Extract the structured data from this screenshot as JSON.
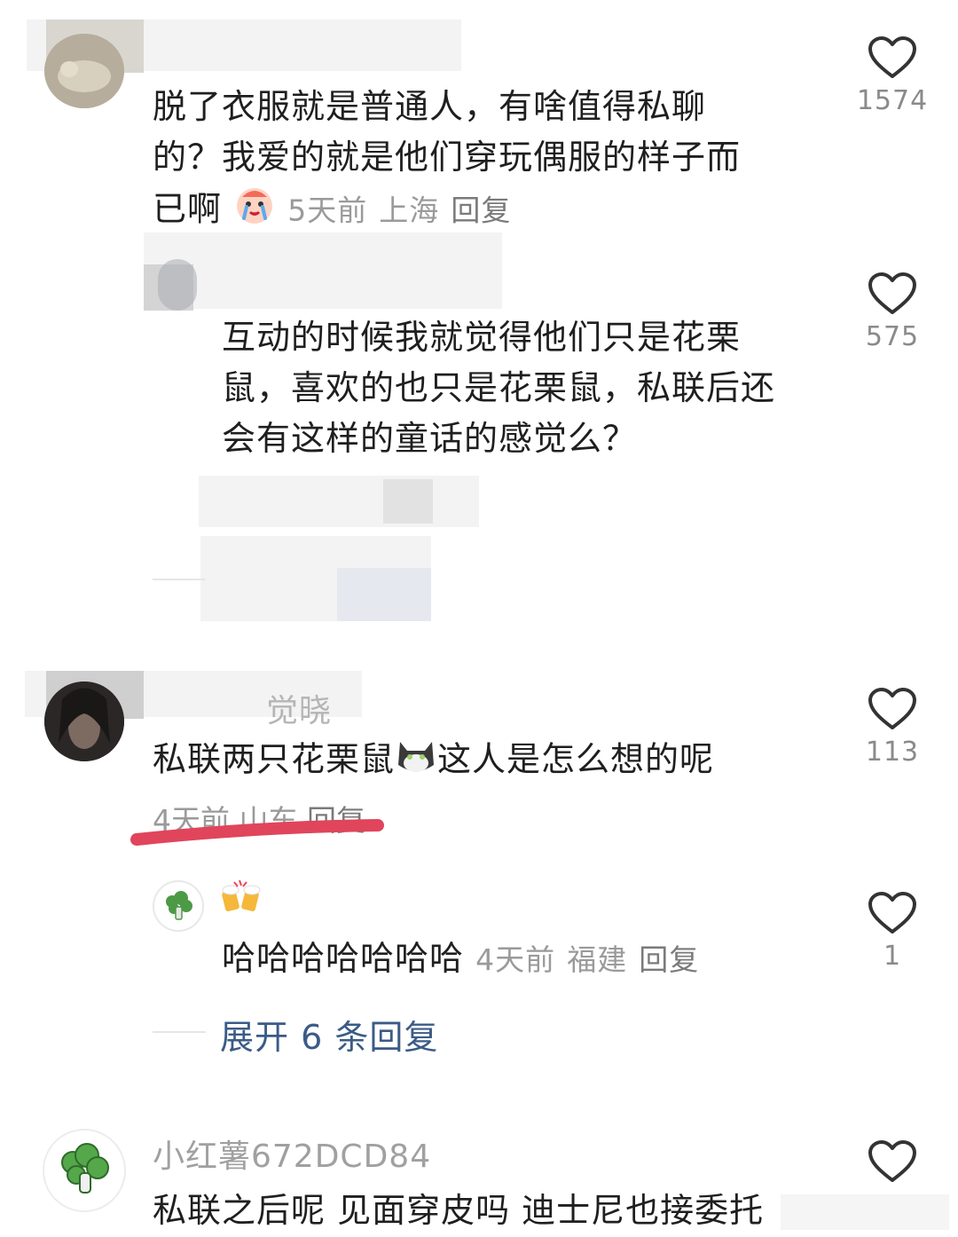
{
  "comments": [
    {
      "text_lines": [
        "脱了衣服就是普通人，有啥值得私聊",
        "的？我爱的就是他们穿玩偶服的样子而",
        "已啊"
      ],
      "emoji": "crying-emoji",
      "time": "5天前",
      "location": "上海",
      "reply_label": "回复",
      "likes": "1574"
    },
    {
      "text_lines": [
        "互动的时候我就觉得他们只是花栗",
        "鼠，喜欢的也只是花栗鼠，私联后还",
        "会有这样的童话的感觉么？"
      ],
      "likes": "575"
    },
    {
      "username_partial": "觉晓",
      "text_before": "私联两只花栗鼠",
      "emoji": "cat-emoji",
      "text_after": "这人是怎么想的呢",
      "time": "4天前",
      "location": "山东",
      "reply_label": "回复",
      "likes": "113"
    },
    {
      "emoji": "beer-cheers-emoji",
      "text": "哈哈哈哈哈哈哈",
      "time": "4天前",
      "location": "福建",
      "reply_label": "回复",
      "likes": "1"
    },
    {
      "username": "小红薯672DCD84",
      "text": "私联之后呢 见面穿皮吗 迪士尼也接委托"
    }
  ],
  "expand_replies": "展开 6 条回复",
  "colors": {
    "highlight_underline": "#e0455b",
    "link_blue": "#3b5b86",
    "meta_gray": "#9a9a9a"
  }
}
